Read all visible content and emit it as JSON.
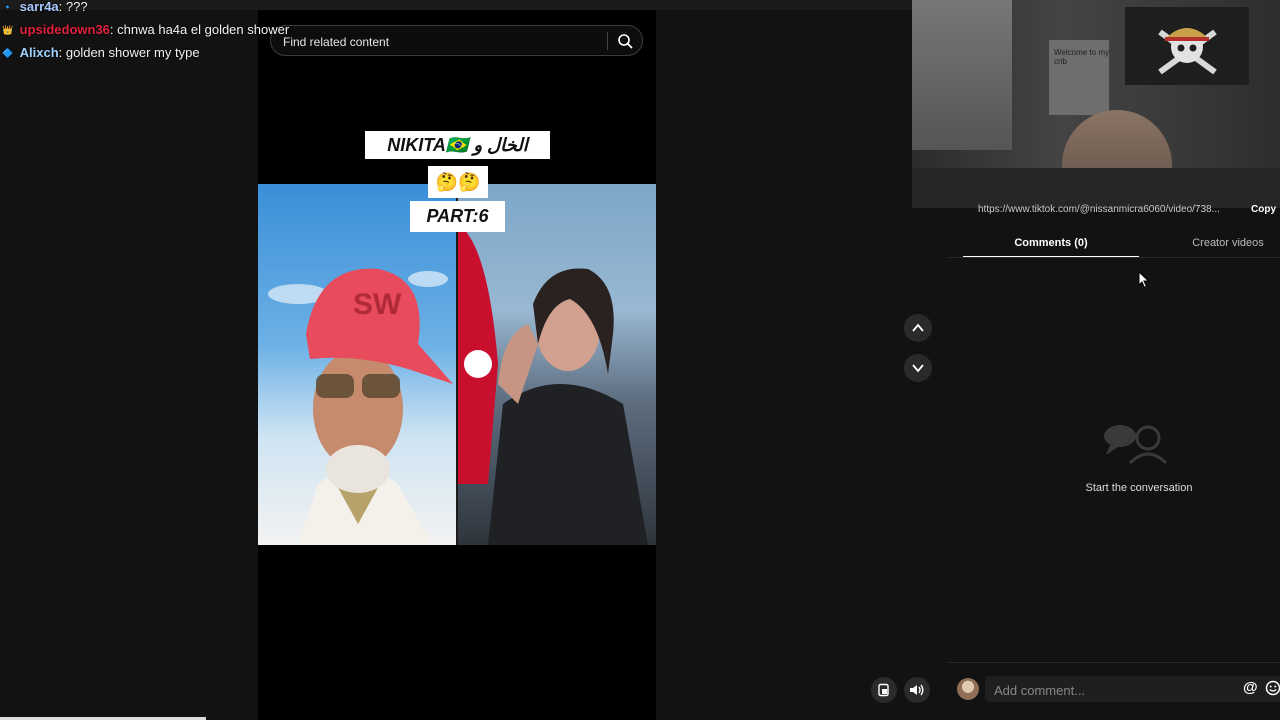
{
  "chat": [
    {
      "user": "sarr4a",
      "user_color": "#a9c8ff",
      "message": "???"
    },
    {
      "user": "upsidedown36",
      "user_color": "#e0213d",
      "message": "chnwa ha4a el golden shower"
    },
    {
      "user": "Alixch",
      "user_color": "#9fd0ff",
      "message": "golden shower my type"
    }
  ],
  "search": {
    "placeholder": "Find related content"
  },
  "video": {
    "caption_line1": "NIKITA🇧🇷 الخال و",
    "caption_line2": "🤔🤔",
    "caption_line3": "PART:6"
  },
  "webcam": {
    "poster_text": "Welcome to my crib"
  },
  "panel": {
    "url": "https://www.tiktok.com/@nissanmicra6060/video/738...",
    "copy_label": "Copy",
    "tabs": [
      {
        "label": "Comments (0)",
        "active": true
      },
      {
        "label": "Creator videos",
        "active": false
      }
    ],
    "empty_state": "Start the conversation",
    "comment_placeholder": "Add comment...",
    "mention_label": "@"
  },
  "colors": {
    "background": "#121212",
    "video_bg": "#000000",
    "accent": "#ffffff"
  }
}
